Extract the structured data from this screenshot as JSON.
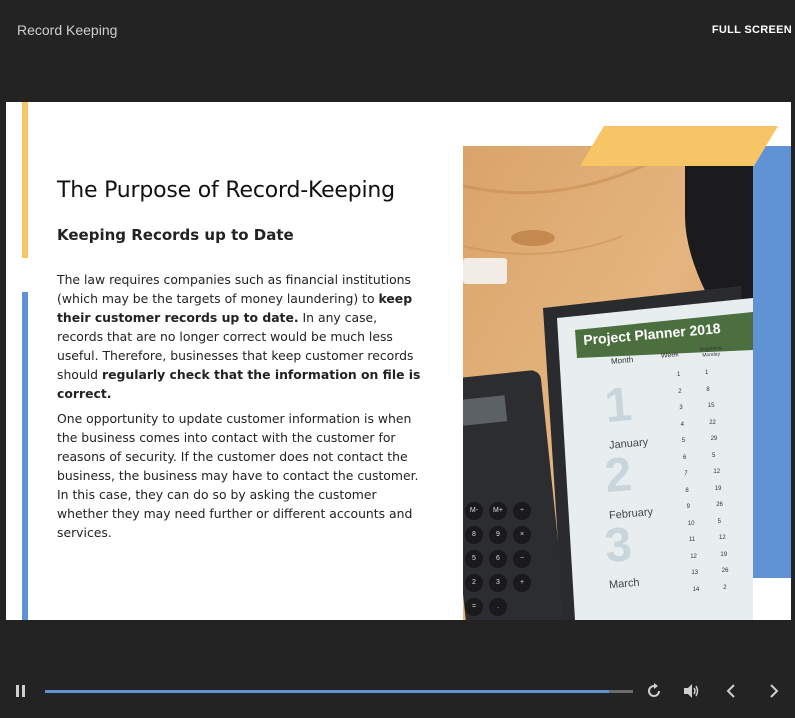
{
  "header": {
    "title": "Record Keeping",
    "fullscreen_label": "FULL SCREEN"
  },
  "slide": {
    "heading": "The Purpose of Record-Keeping",
    "subheading": "Keeping Records up to Date",
    "paragraph1": {
      "a": "The law requires companies such as financial institutions (which may be the targets of money laundering) to ",
      "b": "keep their customer records up to date.",
      "c": " In any case, records that are no longer correct would be much less useful. Therefore, businesses that keep customer records should ",
      "d": "regularly check that the information on file is correct."
    },
    "paragraph2": "One opportunity to update customer information is when the business comes into contact with the customer for reasons of security. If the customer does not contact the business, the business may have to contact the customer. In this case, they can do so by asking the customer whether they may need further or different accounts and services.",
    "image": {
      "planner_title": "Project Planner",
      "planner_year": "2018",
      "col_month": "Month",
      "col_week": "Week",
      "col_beginning": "Beginning Monday",
      "months": [
        {
          "num": "1",
          "name": "January"
        },
        {
          "num": "2",
          "name": "February"
        },
        {
          "num": "3",
          "name": "March"
        }
      ],
      "weeks": [
        "1",
        "2",
        "3",
        "4",
        "5",
        "6",
        "7",
        "8",
        "9",
        "10",
        "11",
        "12",
        "13",
        "14"
      ],
      "days": [
        "1",
        "8",
        "15",
        "22",
        "29",
        "5",
        "12",
        "19",
        "26",
        "5",
        "12",
        "19",
        "26",
        "2"
      ],
      "calc_keys": [
        "M-",
        "M+",
        "÷",
        "8",
        "9",
        "×",
        "5",
        "6",
        "−",
        "2",
        "3",
        "+",
        "=",
        "."
      ]
    },
    "colors": {
      "accent_yellow": "#f7c566",
      "accent_blue": "#5f93d5"
    }
  },
  "player": {
    "progress": 0.96,
    "icons": [
      "pause-icon",
      "replay-icon",
      "volume-icon",
      "prev-icon",
      "next-icon"
    ]
  }
}
